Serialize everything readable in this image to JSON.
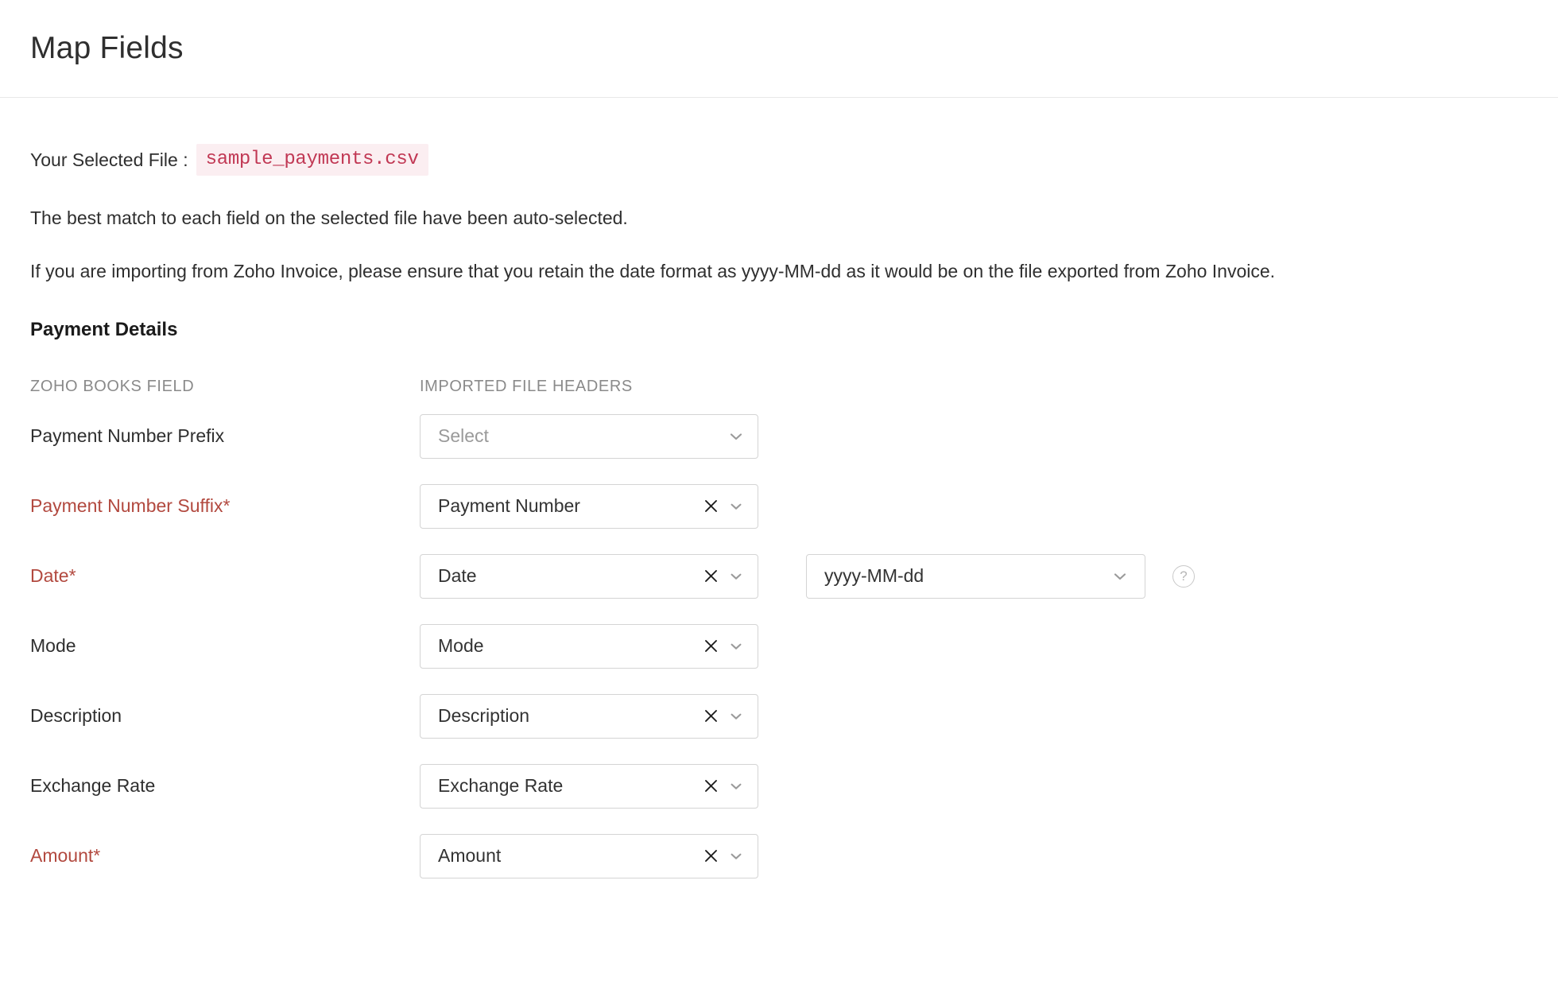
{
  "header": {
    "title": "Map Fields"
  },
  "file_info": {
    "label": "Your Selected File :",
    "filename": "sample_payments.csv"
  },
  "notes": {
    "line1": "The best match to each field on the selected file have been auto-selected.",
    "line2": "If you are importing from Zoho Invoice, please ensure that you retain the date format as yyyy-MM-dd as it would be on the file exported from Zoho Invoice."
  },
  "section": {
    "title": "Payment Details"
  },
  "table": {
    "col_field": "ZOHO BOOKS FIELD",
    "col_header": "IMPORTED FILE HEADERS",
    "rows": [
      {
        "label": "Payment Number Prefix",
        "required": false,
        "value": "Select",
        "is_placeholder": true,
        "clearable": false
      },
      {
        "label": "Payment Number Suffix*",
        "required": true,
        "value": "Payment Number",
        "is_placeholder": false,
        "clearable": true
      },
      {
        "label": "Date*",
        "required": true,
        "value": "Date",
        "is_placeholder": false,
        "clearable": true,
        "date_format": "yyyy-MM-dd",
        "help": "?"
      },
      {
        "label": "Mode",
        "required": false,
        "value": "Mode",
        "is_placeholder": false,
        "clearable": true
      },
      {
        "label": "Description",
        "required": false,
        "value": "Description",
        "is_placeholder": false,
        "clearable": true
      },
      {
        "label": "Exchange Rate",
        "required": false,
        "value": "Exchange Rate",
        "is_placeholder": false,
        "clearable": true
      },
      {
        "label": "Amount*",
        "required": true,
        "value": "Amount",
        "is_placeholder": false,
        "clearable": true
      }
    ]
  },
  "icons": {
    "clear": "clear-icon",
    "chevron": "chevron-down-icon",
    "help": "help-circle-icon"
  },
  "colors": {
    "required": "#b2493f",
    "filename_text": "#c13854",
    "filename_bg": "#fbeef1",
    "border": "#d4d4d4"
  }
}
